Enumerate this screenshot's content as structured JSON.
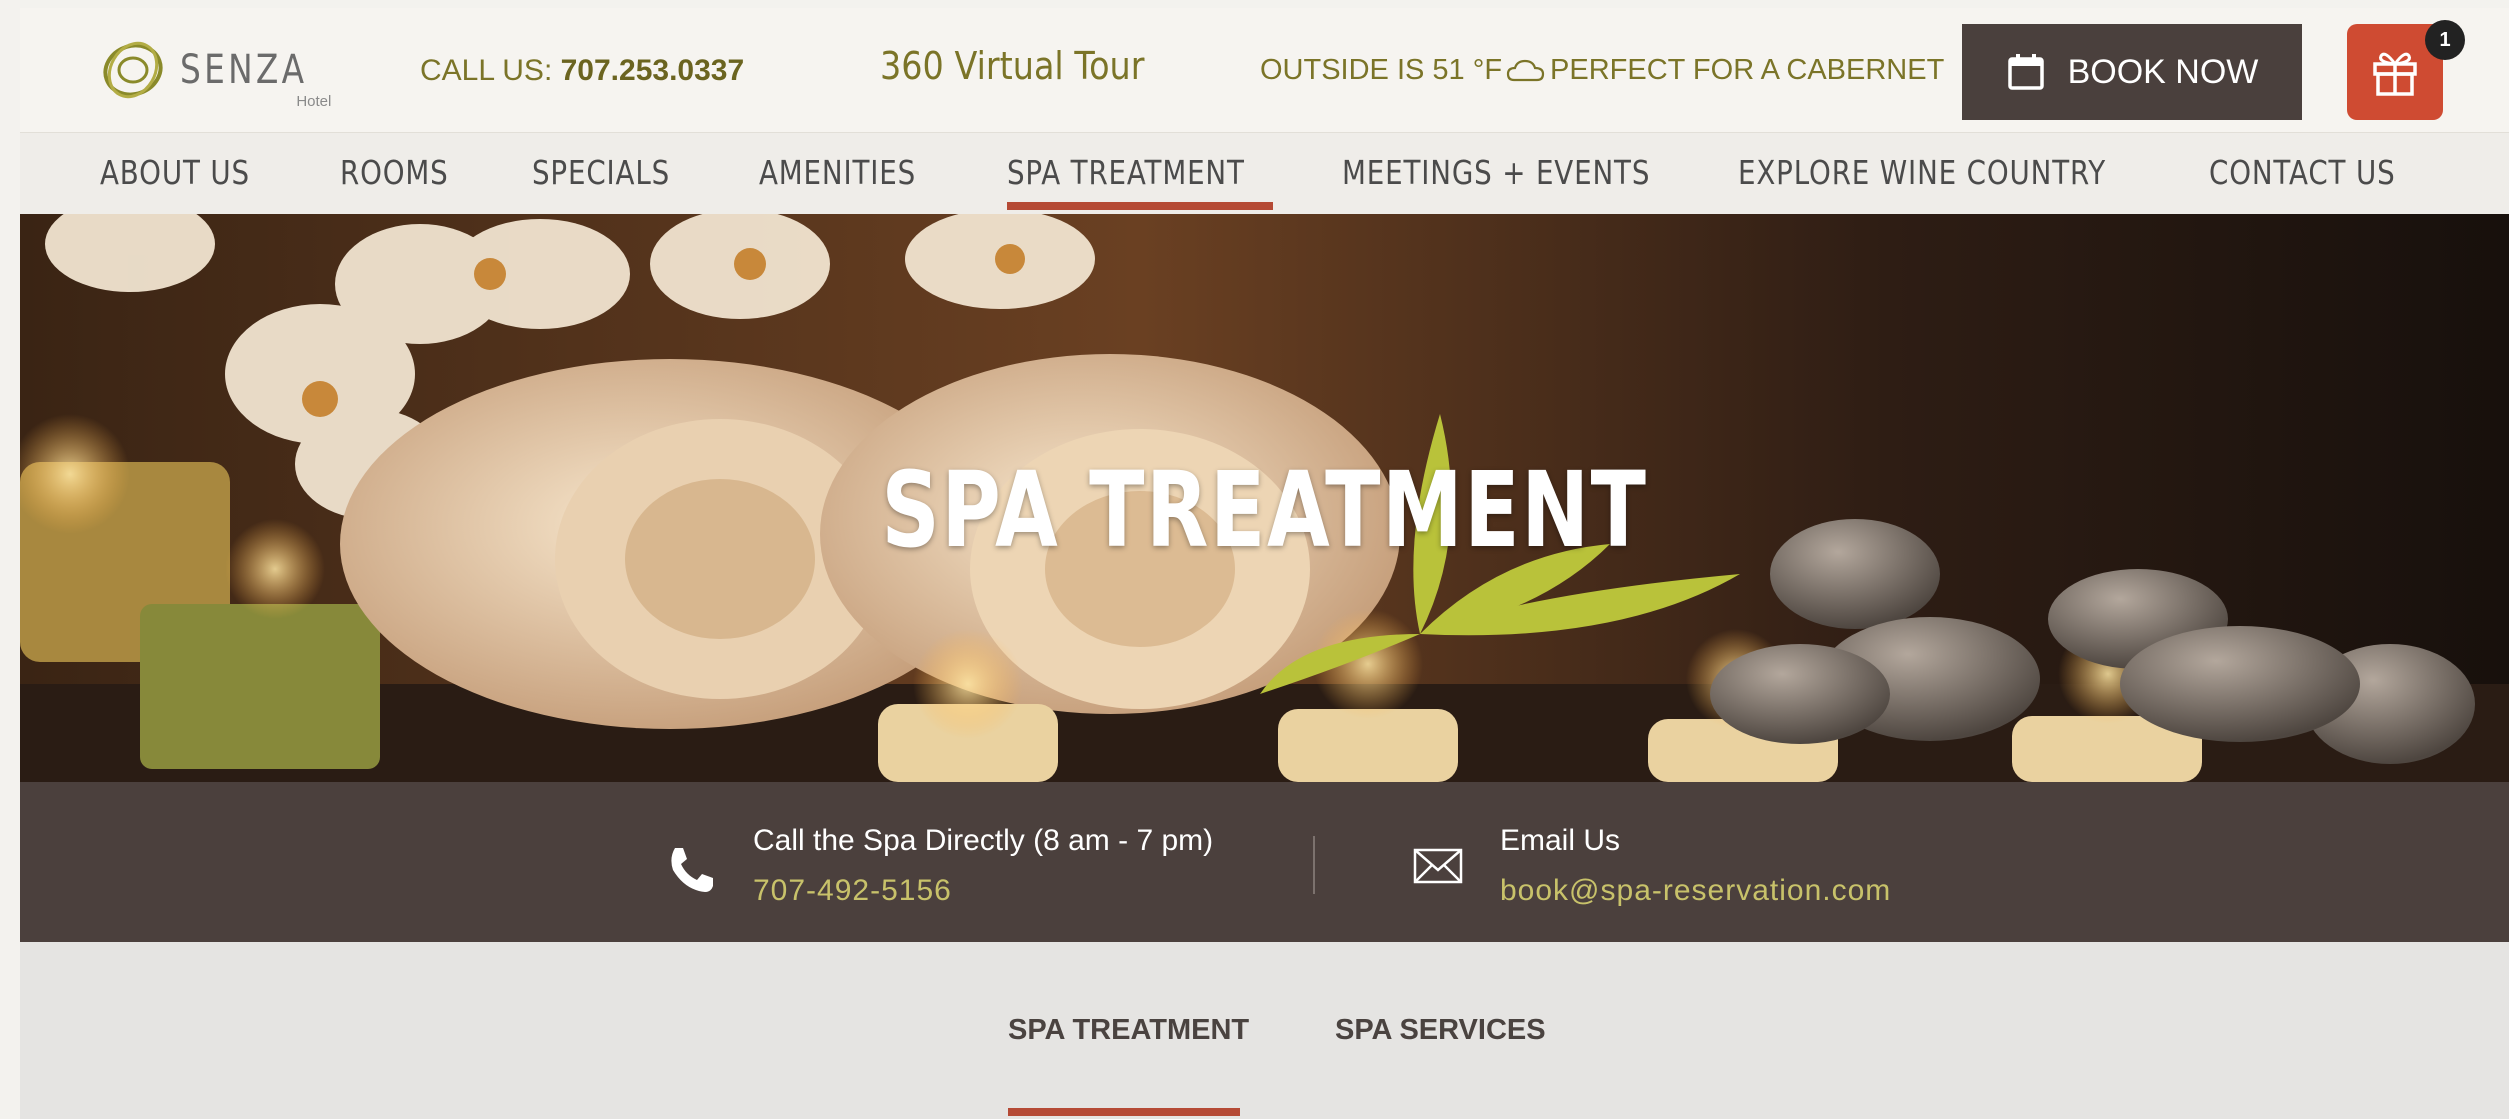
{
  "brand": {
    "name": "SENZA",
    "subtitle": "Hotel"
  },
  "header": {
    "call_us_label": "CALL US:",
    "call_us_number": "707.253.0337",
    "virtual_tour": "360 Virtual Tour",
    "weather_prefix": "OUTSIDE IS 51 °F",
    "weather_suffix": "PERFECT FOR A CABERNET",
    "book_now": "BOOK NOW",
    "gift_badge": "1"
  },
  "nav": {
    "items": [
      {
        "label": "ABOUT US"
      },
      {
        "label": "ROOMS"
      },
      {
        "label": "SPECIALS"
      },
      {
        "label": "AMENITIES"
      },
      {
        "label": "SPA TREATMENT",
        "active": true
      },
      {
        "label": "MEETINGS + EVENTS"
      },
      {
        "label": "EXPLORE WINE COUNTRY"
      },
      {
        "label": "CONTACT US"
      }
    ]
  },
  "hero": {
    "title": "SPA TREATMENT"
  },
  "contact": {
    "phone_label": "Call the Spa Directly (8 am - 7 pm)",
    "phone_value": "707-492-5156",
    "email_label": "Email Us",
    "email_value": "book@spa-reservation.com"
  },
  "subtabs": [
    {
      "label": "SPA TREATMENT",
      "active": true
    },
    {
      "label": "SPA SERVICES"
    }
  ],
  "colors": {
    "accent": "#b54a35",
    "gold_text": "#7b7428",
    "dark_band": "#4b403d",
    "book_button": "#4a403d",
    "gift_button": "#cf4b32"
  },
  "icons": [
    "senza-logo-icon",
    "cloud-icon",
    "calendar-icon",
    "gift-icon",
    "phone-icon",
    "mail-icon"
  ]
}
